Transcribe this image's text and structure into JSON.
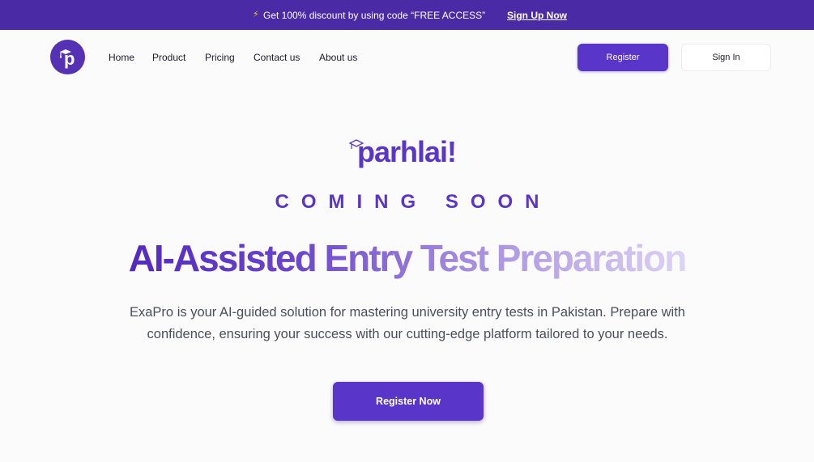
{
  "promo": {
    "bolt": "⚡",
    "text": "Get 100% discount by using code “FREE ACCESS”",
    "link": "Sign Up Now"
  },
  "nav": {
    "logo_letter": "p",
    "links": [
      "Home",
      "Product",
      "Pricing",
      "Contact us",
      "About us"
    ],
    "register": "Register",
    "signin": "Sign In"
  },
  "hero": {
    "brand": "parhlai!",
    "coming_soon": "COMING SOON",
    "headline": "AI-Assisted Entry Test Preparation",
    "description": "ExaPro is your AI-guided solution for mastering university entry tests in Pakistan. Prepare with confidence, ensuring your success with our cutting-edge platform tailored to your needs.",
    "cta": "Register Now"
  },
  "colors": {
    "brand": "#5a35c9",
    "banner": "#4b2aa6",
    "background": "#fbfbfb"
  },
  "icons": [
    "lightning-icon",
    "graduation-cap-icon"
  ]
}
